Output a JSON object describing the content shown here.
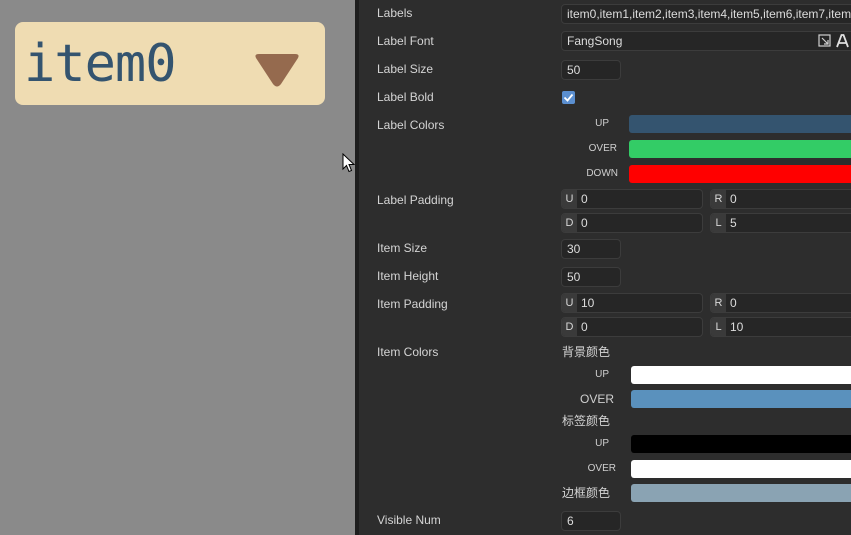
{
  "preview": {
    "dropdown_label": "item0",
    "colors": {
      "box_bg": "#efdcb2",
      "label": "#34546f",
      "arrow": "#956a4e"
    }
  },
  "panel": {
    "labels": {
      "label": "Labels",
      "value": "item0,item1,item2,item3,item4,item5,item6,item7,item"
    },
    "label_font": {
      "label": "Label Font",
      "value": "FangSong"
    },
    "label_size": {
      "label": "Label Size",
      "value": "50"
    },
    "label_bold": {
      "label": "Label Bold",
      "checked": true
    },
    "label_colors": {
      "label": "Label Colors",
      "states": [
        {
          "name": "UP",
          "color": "#34546f"
        },
        {
          "name": "OVER",
          "color": "#33cc66"
        },
        {
          "name": "DOWN",
          "color": "#ff0000"
        }
      ]
    },
    "label_padding": {
      "label": "Label Padding",
      "u": {
        "tag": "U",
        "value": "0"
      },
      "r": {
        "tag": "R",
        "value": "0"
      },
      "d": {
        "tag": "D",
        "value": "0"
      },
      "l": {
        "tag": "L",
        "value": "5"
      }
    },
    "item_size": {
      "label": "Item Size",
      "value": "30"
    },
    "item_height": {
      "label": "Item Height",
      "value": "50"
    },
    "item_padding": {
      "label": "Item Padding",
      "u": {
        "tag": "U",
        "value": "10"
      },
      "r": {
        "tag": "R",
        "value": "0"
      },
      "d": {
        "tag": "D",
        "value": "0"
      },
      "l": {
        "tag": "L",
        "value": "10"
      }
    },
    "item_colors": {
      "label": "Item Colors",
      "bg_title": "背景颜色",
      "bg_up": {
        "name": "UP",
        "color": "#ffffff"
      },
      "bg_over": {
        "name": "OVER",
        "color": "#5a91bd"
      },
      "label_title": "标签颜色",
      "label_up": {
        "name": "UP",
        "color": "#000000"
      },
      "label_over": {
        "name": "OVER",
        "color": "#ffffff"
      },
      "border_title": "边框颜色",
      "border_color": "#8aa3b3"
    },
    "visible_num": {
      "label": "Visible Num",
      "value": "6"
    }
  }
}
